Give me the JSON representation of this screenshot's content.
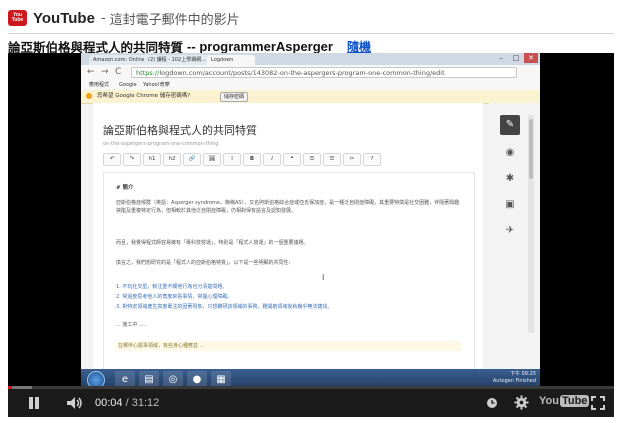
{
  "header": {
    "logo_line1": "You",
    "logo_line2": "Tube",
    "brand": "YouTube",
    "separator": "-",
    "subtitle": "這封電子郵件中的影片"
  },
  "video": {
    "title": "論亞斯伯格與程式人的共同特質",
    "separator": "--",
    "author": "programmerAsperger",
    "unsubscribe_label": "隨機"
  },
  "browser": {
    "tabs": [
      "Amazon.com: Online Sh...",
      "(2) 課程 - 102上學期網...",
      "Logdown"
    ],
    "window_buttons": [
      "–",
      "□",
      "✕"
    ],
    "nav": [
      "←",
      "→",
      "C"
    ],
    "url_scheme": "https://",
    "url_rest": "logdown.com/account/posts/143082-on-the-aspergers-program-one-common-thing/edit",
    "bookmarks": [
      "應用程式",
      "Google",
      "Yahoo!奇摩"
    ],
    "infobar_message": "您希望 Google Chrome 儲存密碼嗎?",
    "infobar_button": "儲存密碼"
  },
  "editor": {
    "title": "論亞斯伯格與程式人的共同特質",
    "slug": "on-the-aspergers-program-one-common-thing",
    "toolbar": [
      "↶",
      "↷",
      "h1",
      "h2",
      "🔗",
      "🖼",
      "I",
      "B",
      "I",
      "❝",
      "☰",
      "☰",
      "✂",
      "?"
    ],
    "heading": "# 簡介",
    "paragraph1": "亞斯伯格症候群（英語：Asperger syndrome，簡稱AS），又名阿斯伯格綜合症或亞氏保加症，是一種泛自閉症障礙，其重要特徵是社交困難，伴隨著興趣狹隘及重複特定行為，但相較於其他泛自閉症障礙，仍相對保有語言及認知發展。",
    "paragraph2": "而且，我覺得程式師容易擁有「專科技營運」，特別是「程式人營運」的一個重要議題。",
    "paragraph3": "換言之，我們想研究的是「程式人的亞斯伯格特質」，以下是一些明顯的共同性：",
    "list": [
      "1. 不玩社交型，較注重不關他行為也分清楚問題。",
      "2. 常過度思考他人的角度來看事情，常擅心理障礙。",
      "3. 對特定領域產生高度專注的固著現象，只想鑽研該領域的事務，難開啟領域後就幾乎無法捷找。"
    ],
    "ellipsis": "... 施工中 .....",
    "quote": "在哪伴心擺事領域，有些身心種應並 ...",
    "cursor_glyph": "I"
  },
  "sidebar_icons": [
    "edit-icon",
    "preview-icon",
    "settings-icon",
    "save-icon",
    "publish-icon"
  ],
  "sidebar_glyphs": [
    "✎",
    "◉",
    "✱",
    "▣",
    "✈"
  ],
  "taskbar": {
    "clock_time": "下午 09:25",
    "clock_label": "Autogen Finished"
  },
  "player": {
    "current_time": "00:04",
    "time_separator": "/",
    "duration": "31:12",
    "progress_fraction": 0.002,
    "buffer_fraction": 0.04,
    "logo_left": "You",
    "logo_right": "Tube"
  },
  "colors": {
    "youtube_red": "#cc181e",
    "link_blue": "#1155cc",
    "player_bg": "#000000"
  }
}
